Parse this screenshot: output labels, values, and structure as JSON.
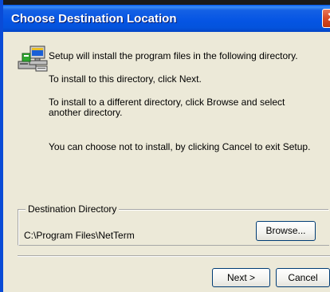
{
  "window": {
    "title": "Choose Destination Location",
    "close_glyph": "✕"
  },
  "icons": {
    "setup": "setup-computer-icon"
  },
  "body": {
    "line1": "Setup will install the program files in the following directory.",
    "line2": "To install to this directory, click Next.",
    "line3a": "To install to a different directory, click Browse and select",
    "line3b": "another directory.",
    "line4": "You can choose not to install, by clicking Cancel to exit Setup."
  },
  "destination": {
    "group_label": "Destination Directory",
    "path": "C:\\Program Files\\NetTerm",
    "browse_label": "Browse..."
  },
  "buttons": {
    "next_label": "Next >",
    "cancel_label": "Cancel"
  },
  "colors": {
    "titlebar": "#0554e3",
    "close": "#d84a25",
    "dialog_bg": "#ece9d8",
    "button_border": "#003c74"
  }
}
